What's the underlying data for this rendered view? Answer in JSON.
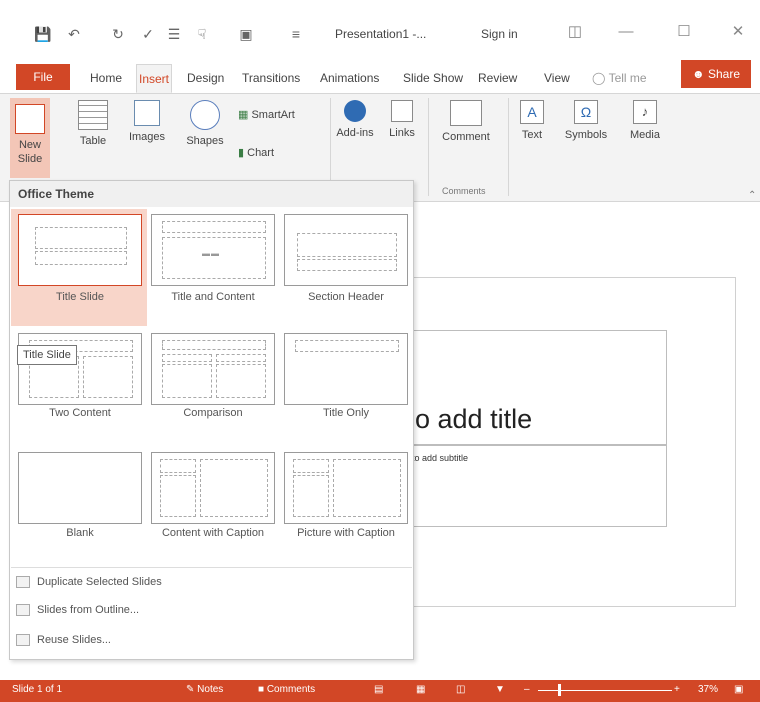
{
  "window": {
    "title": "Presentation1 -...",
    "sign_in": "Sign in"
  },
  "tabs": [
    {
      "label": "File"
    },
    {
      "label": "Home"
    },
    {
      "label": "Insert"
    },
    {
      "label": "Design"
    },
    {
      "label": "Transitions"
    },
    {
      "label": "Animations"
    },
    {
      "label": "Slide Show"
    },
    {
      "label": "Review"
    },
    {
      "label": "View"
    }
  ],
  "tell_me": "Tell me",
  "share": "Share",
  "ribbon": {
    "new_slide": "New Slide",
    "table": "Table",
    "images": "Images",
    "shapes": "Shapes",
    "smartart": "SmartArt",
    "chart": "Chart",
    "addins": "Add-ins",
    "links": "Links",
    "comment": "Comment",
    "text": "Text",
    "symbols": "Symbols",
    "media": "Media",
    "comments_group": "Comments"
  },
  "gallery": {
    "header": "Office Theme",
    "layouts": [
      {
        "label": "Title Slide"
      },
      {
        "label": "Title and Content"
      },
      {
        "label": "Section Header"
      },
      {
        "label": "Two Content"
      },
      {
        "label": "Comparison"
      },
      {
        "label": "Title Only"
      },
      {
        "label": "Blank"
      },
      {
        "label": "Content with Caption"
      },
      {
        "label": "Picture with Caption"
      }
    ],
    "menu": [
      {
        "label": "Duplicate Selected Slides"
      },
      {
        "label": "Slides from Outline..."
      },
      {
        "label": "Reuse Slides..."
      }
    ],
    "tooltip": "Title Slide"
  },
  "slide": {
    "title_placeholder": "o add title",
    "subtitle_placeholder": "to add subtitle"
  },
  "status": {
    "slide_count": "Slide 1 of 1",
    "notes": "Notes",
    "comments": "Comments",
    "zoom": "37%"
  },
  "colors": {
    "accent": "#d24726",
    "highlight": "#f8d5c9"
  }
}
